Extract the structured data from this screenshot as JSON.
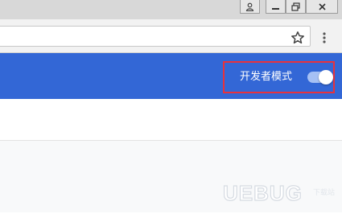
{
  "titlebar": {
    "buttons": [
      {
        "name": "user-profile",
        "icon": "person-icon"
      },
      {
        "name": "minimize",
        "icon": "minimize-icon"
      },
      {
        "name": "restore",
        "icon": "restore-icon"
      },
      {
        "name": "close",
        "icon": "close-icon"
      }
    ]
  },
  "toolbar": {
    "address_value": "",
    "bookmark_icon": "star-icon",
    "menu_icon": "more-vertical-icon"
  },
  "extensions_header": {
    "developer_mode_label": "开发者模式",
    "developer_mode_enabled": true
  },
  "watermark": {
    "text": "UEBUG",
    "sub_text": "下载站"
  },
  "colors": {
    "header_blue": "#3367d6",
    "highlight_red": "#e8323c",
    "toggle_track": "#a6c0f4",
    "page_background": "#f8f9fa"
  }
}
